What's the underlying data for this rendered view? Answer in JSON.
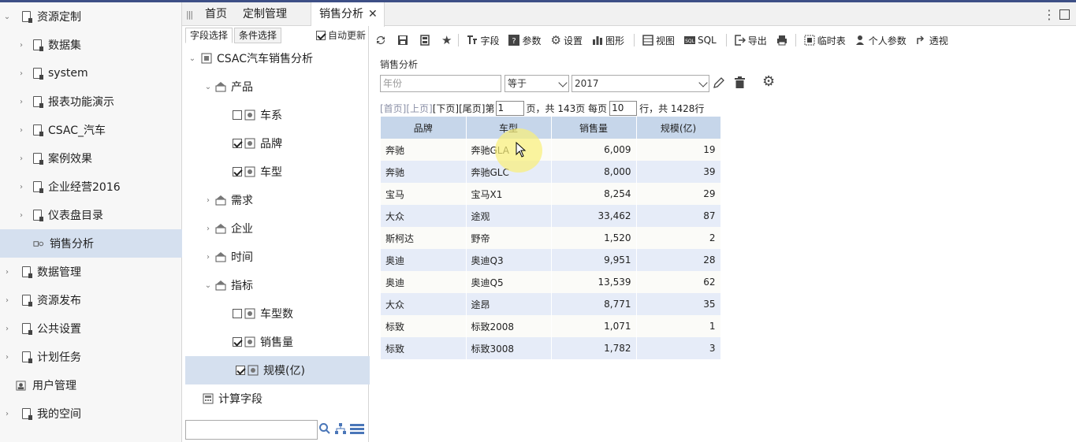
{
  "nav": {
    "items": [
      {
        "label": "资源定制",
        "caret": "⌄"
      },
      {
        "label": "数据集",
        "caret": "›"
      },
      {
        "label": "system",
        "caret": "›"
      },
      {
        "label": "报表功能演示",
        "caret": "›"
      },
      {
        "label": "CSAC_汽车",
        "caret": "›"
      },
      {
        "label": "案例效果",
        "caret": "›"
      },
      {
        "label": "企业经营2016",
        "caret": "›"
      },
      {
        "label": "仪表盘目录",
        "caret": "›"
      },
      {
        "label": "销售分析",
        "caret": ""
      },
      {
        "label": "数据管理",
        "caret": "›"
      },
      {
        "label": "资源发布",
        "caret": "›"
      },
      {
        "label": "公共设置",
        "caret": "›"
      },
      {
        "label": "计划任务",
        "caret": "›"
      },
      {
        "label": "用户管理",
        "caret": ""
      },
      {
        "label": "我的空间",
        "caret": "›"
      }
    ]
  },
  "tabs": {
    "home": "首页",
    "custom": "定制管理",
    "sales": "销售分析",
    "close": "✕"
  },
  "fieldpanel": {
    "tab_fields": "字段选择",
    "tab_conditions": "条件选择",
    "auto_update": "自动更新",
    "tree": [
      {
        "label": "CSAC汽车销售分析"
      },
      {
        "label": "产品"
      },
      {
        "label": "车系",
        "checked": false
      },
      {
        "label": "品牌",
        "checked": true
      },
      {
        "label": "车型",
        "checked": true
      },
      {
        "label": "需求"
      },
      {
        "label": "企业"
      },
      {
        "label": "时间"
      },
      {
        "label": "指标"
      },
      {
        "label": "车型数",
        "checked": false
      },
      {
        "label": "销售量",
        "checked": true
      },
      {
        "label": "规模(亿)",
        "checked": true
      },
      {
        "label": "计算字段"
      }
    ]
  },
  "toolbar": {
    "field": "字段",
    "param": "参数",
    "settings": "设置",
    "chart": "图形",
    "view": "视图",
    "sql": "SQL",
    "export": "导出",
    "temp_table": "临时表",
    "personal_param": "个人参数",
    "pivot": "透视"
  },
  "report": {
    "title": "销售分析",
    "filter_field_placeholder": "年份",
    "filter_op": "等于",
    "filter_value": "2017"
  },
  "pager": {
    "first": "[首页]",
    "prev": "[上页]",
    "next": "[下页]",
    "last": "[尾页]",
    "page_prefix": "第",
    "page": "1",
    "page_mid": "页，共 143页 每页",
    "per_page": "10",
    "row_suffix": "行，共 1428行"
  },
  "table": {
    "headers": [
      "品牌",
      "车型",
      "销售量",
      "规模(亿)"
    ],
    "rows": [
      [
        "奔驰",
        "奔驰GLA",
        "6,009",
        "19"
      ],
      [
        "奔驰",
        "奔驰GLC",
        "8,000",
        "39"
      ],
      [
        "宝马",
        "宝马X1",
        "8,254",
        "29"
      ],
      [
        "大众",
        "途观",
        "33,462",
        "87"
      ],
      [
        "斯柯达",
        "野帝",
        "1,520",
        "2"
      ],
      [
        "奥迪",
        "奥迪Q3",
        "9,951",
        "28"
      ],
      [
        "奥迪",
        "奥迪Q5",
        "13,539",
        "62"
      ],
      [
        "大众",
        "途昂",
        "8,771",
        "35"
      ],
      [
        "标致",
        "标致2008",
        "1,071",
        "1"
      ],
      [
        "标致",
        "标致3008",
        "1,782",
        "3"
      ]
    ]
  }
}
